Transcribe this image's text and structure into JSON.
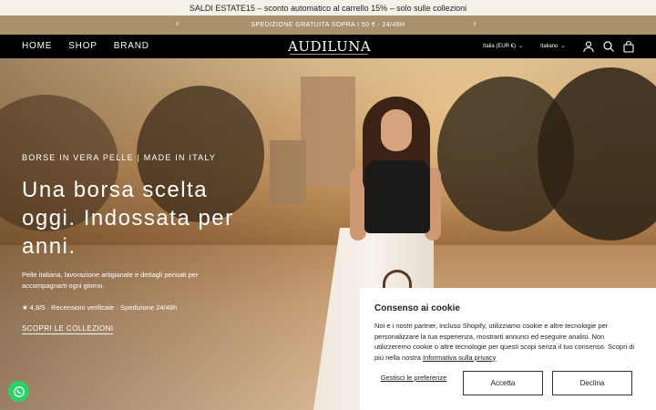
{
  "announcement": {
    "promo_text": "SALDI ESTATE15 – sconto automatico al carrello 15% – solo sulle collezioni",
    "shipping_text": "SPEDIZIONE GRATUITA SOPRA I 50 € - 24/48H",
    "prev_icon": "chevron-left-icon",
    "next_icon": "chevron-right-icon"
  },
  "header": {
    "nav": [
      "HOME",
      "SHOP",
      "BRAND"
    ],
    "logo_text": "AUDILUNA",
    "country_selector": "Italia (EUR €)",
    "language_selector": "Italiano",
    "icons": [
      "account-icon",
      "search-icon",
      "cart-icon"
    ]
  },
  "hero": {
    "eyebrow": "BORSE IN VERA PELLE | MADE IN ITALY",
    "title": "Una borsa scelta oggi. Indossata per anni.",
    "subtitle": "Pelle italiana, lavorazione artigianale e dettagli pensati per accompagnarti ogni giorno.",
    "rating_line": "★ 4,8/5 · Recensioni verificate · Spedizione 24/48h",
    "cta_label": "SCOPRI LE COLLEZIONI"
  },
  "cookie_banner": {
    "title": "Consenso ai cookie",
    "body": "Noi e i nostri partner, incluso Shopify, utilizziamo cookie e altre tecnologie per personalizzare la tua esperienza, mostrarti annunci ed eseguire analisi. Non utilizzeremo cookie o altre tecnologie per questi scopi senza il tuo consenso. Scopri di più nella nostra",
    "privacy_link": "Informativa sulla privacy",
    "manage_label": "Gestisci le preferenze",
    "accept_label": "Accetta",
    "decline_label": "Declina"
  },
  "floating": {
    "whatsapp_icon": "whatsapp-icon"
  },
  "colors": {
    "shipping_bar": "#a9916d",
    "header_bg": "#000000",
    "whatsapp": "#25d366"
  }
}
